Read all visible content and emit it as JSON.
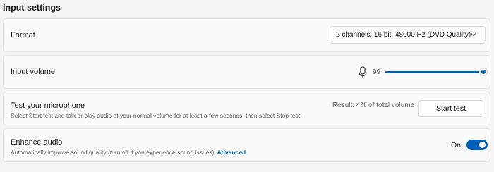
{
  "section": {
    "title": "Input settings"
  },
  "format": {
    "label": "Format",
    "selected": "2 channels, 16 bit, 48000 Hz (DVD Quality)",
    "chevron_icon": "chevron-down-icon"
  },
  "input_volume": {
    "label": "Input volume",
    "mic_icon": "microphone-icon",
    "value_text": "99",
    "value": 99,
    "max": 100
  },
  "test_microphone": {
    "title": "Test your microphone",
    "description": "Select Start test and talk or play audio at your normal volume for at least a few seconds, then select Stop test",
    "result": "Result: 4% of total volume",
    "button_label": "Start test"
  },
  "enhance_audio": {
    "title": "Enhance audio",
    "description": "Automatically improve sound quality (turn off if you experience sound issues)",
    "link_label": "Advanced",
    "state_label": "On",
    "enabled": true
  },
  "colors": {
    "accent": "#005fb8",
    "link": "#005a9e",
    "background": "#f3f3f3",
    "card": "#fbfbfb"
  }
}
